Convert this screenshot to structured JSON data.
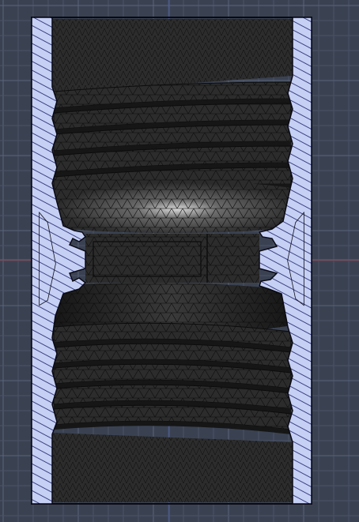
{
  "viewport": {
    "name": "cad-section-viewport",
    "background": "#3a4252",
    "grid_minor_color": "#4a5365",
    "grid_major_color": "#5a6478",
    "axis_x_color": "#a8454f",
    "axis_y_color": "#4a5fb0"
  },
  "section": {
    "hatch_fill": "#c6d0f4",
    "hatch_stroke": "#1a1f66",
    "outline": "#0a0a14"
  },
  "mesh": {
    "base": "#2c2c2c",
    "edge": "#0c0c0c",
    "highlight": "#d8d8d8",
    "shade_dark": "#161616"
  },
  "features": {
    "upper_thread_count": 5,
    "lower_thread_count": 5,
    "groove_count": 2
  }
}
